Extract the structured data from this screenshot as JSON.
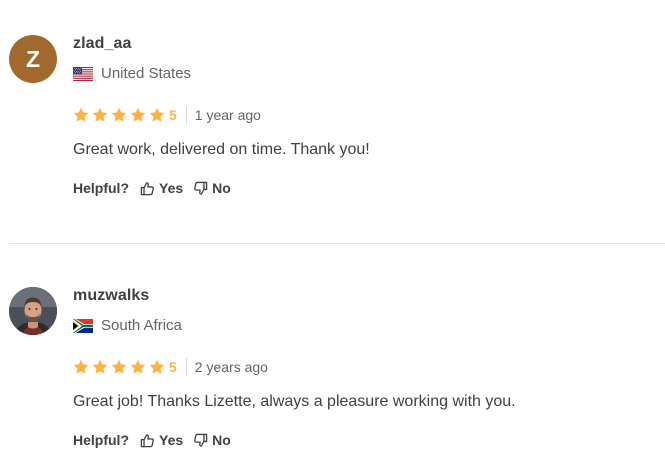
{
  "reviews": [
    {
      "avatar_letter": "Z",
      "username": "zlad_aa",
      "country": "United States",
      "flag": "us-flag",
      "rating": "5",
      "time": "1 year ago",
      "comment": "Great work, delivered on time. Thank you!",
      "helpful_label": "Helpful?",
      "yes_label": "Yes",
      "no_label": "No"
    },
    {
      "avatar_letter": "",
      "username": "muzwalks",
      "country": "South Africa",
      "flag": "south-africa-flag",
      "rating": "5",
      "time": "2 years ago",
      "comment": "Great job! Thanks Lizette, always a pleasure working with you.",
      "helpful_label": "Helpful?",
      "yes_label": "Yes",
      "no_label": "No"
    }
  ],
  "colors": {
    "star": "#ffb33e",
    "avatar_bg": "#a1692e",
    "text": "#404145",
    "muted": "#62646a",
    "divider": "#e4e5e7"
  },
  "icons": {
    "star": "star-icon",
    "thumbs_up": "thumbs-up-icon",
    "thumbs_down": "thumbs-down-icon"
  }
}
